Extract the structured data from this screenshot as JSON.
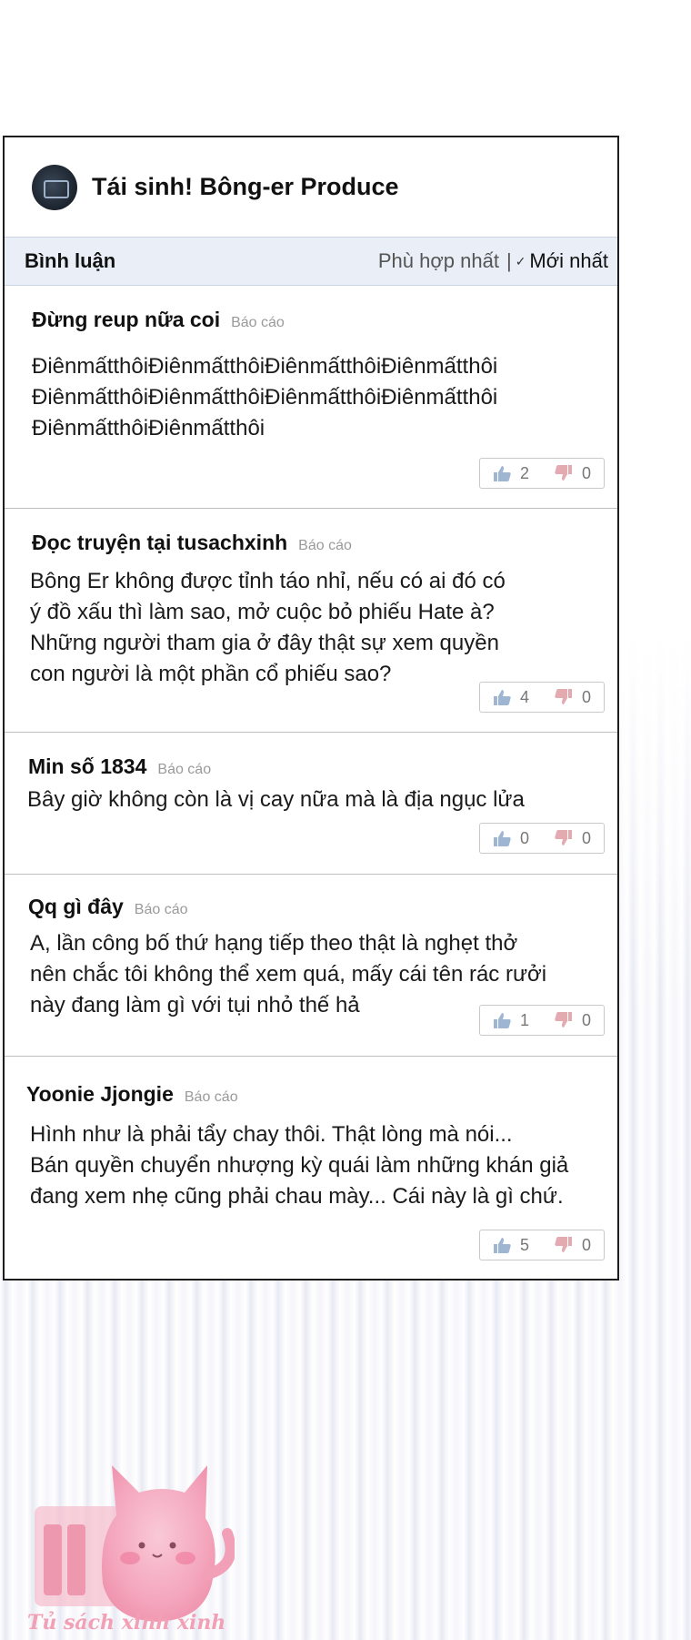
{
  "header": {
    "title": "Tái sinh! Bông-er Produce",
    "avatar_icon": "book-cover-avatar"
  },
  "tabbar": {
    "label": "Bình luận",
    "sort_options": [
      "Phù hợp nhất",
      "Mới nhất"
    ],
    "separator": "|"
  },
  "comments": [
    {
      "author": "Đừng reup nữa coi",
      "report": "Báo cáo",
      "body": "ĐiênmấtthôiĐiênmấtthôiĐiênmấtthôiĐiênmấtthôi\nĐiênmấtthôiĐiênmấtthôiĐiênmấtthôiĐiênmấtthôi\nĐiênmấtthôiĐiênmấtthôi",
      "likes": "2",
      "dislikes": "0"
    },
    {
      "author": "Đọc truyện tại tusachxinh",
      "report": "Báo cáo",
      "body": "Bông Er không được tỉnh táo nhỉ, nếu có ai đó có\ný đồ xấu thì làm sao, mở cuộc bỏ phiếu Hate à?\nNhững người tham gia ở đây thật sự xem quyền\ncon người là một phần cổ phiếu sao?",
      "likes": "4",
      "dislikes": "0"
    },
    {
      "author": "Min số 1834",
      "report": "Báo cáo",
      "body": "Bây giờ không còn là vị cay nữa mà là địa ngục lửa",
      "likes": "0",
      "dislikes": "0"
    },
    {
      "author": "Qq gì đây",
      "report": "Báo cáo",
      "body": "A, lần công bố thứ hạng tiếp theo thật là nghẹt thở\nnên chắc tôi không thể xem quá, mấy cái tên rác rưởi\nnày đang làm gì với tụi nhỏ thế hả",
      "likes": "1",
      "dislikes": "0"
    },
    {
      "author": "Yoonie Jjongie",
      "report": "Báo cáo",
      "body": "Hình như là phải tẩy chay thôi. Thật lòng mà nói...\nBán quyền chuyển nhượng kỳ quái làm những khán giả\nđang xem nhẹ cũng phải chau mày... Cái này là gì chứ.",
      "likes": "5",
      "dislikes": "0"
    }
  ],
  "watermark": {
    "text": "Tủ sách xinh xinh",
    "mascot_icon": "pink-cat-mascot"
  },
  "colors": {
    "tabbar_bg": "#e9eef7",
    "like_icon": "#9fb6d3",
    "dislike_icon": "#e3aab0",
    "watermark": "#f2a0b6"
  }
}
